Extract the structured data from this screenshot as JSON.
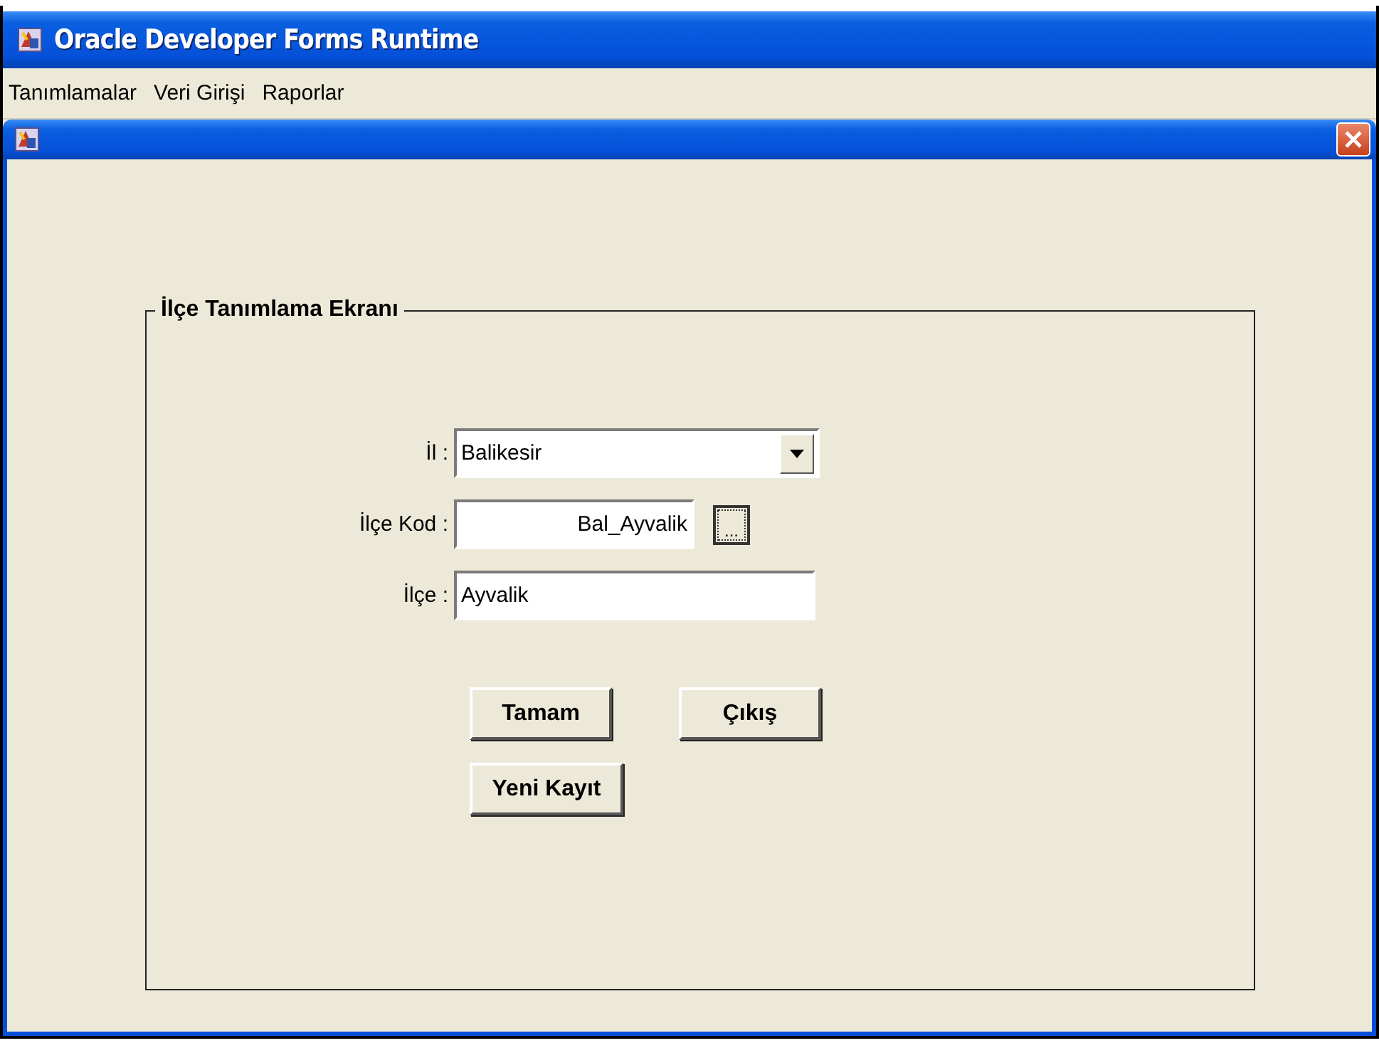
{
  "window": {
    "title": "Oracle Developer Forms Runtime"
  },
  "menu": [
    {
      "label": "Tanımlamalar"
    },
    {
      "label": "Veri Girişi"
    },
    {
      "label": "Raporlar"
    }
  ],
  "form": {
    "title": "İlçe Tanımlama Ekranı",
    "fields": [
      {
        "kind": "dropdown",
        "label": "İl :",
        "value": "Balikesir"
      },
      {
        "kind": "lookup",
        "label": "İlçe Kod :",
        "value": "Bal_Ayvalik",
        "button": "...",
        "focused": true
      },
      {
        "kind": "text",
        "label": "İlçe :",
        "value": "Ayvalik"
      }
    ],
    "buttons": [
      {
        "label": "Tamam"
      },
      {
        "label": "Çıkış"
      },
      {
        "label": "Yeni Kayıt"
      }
    ]
  }
}
